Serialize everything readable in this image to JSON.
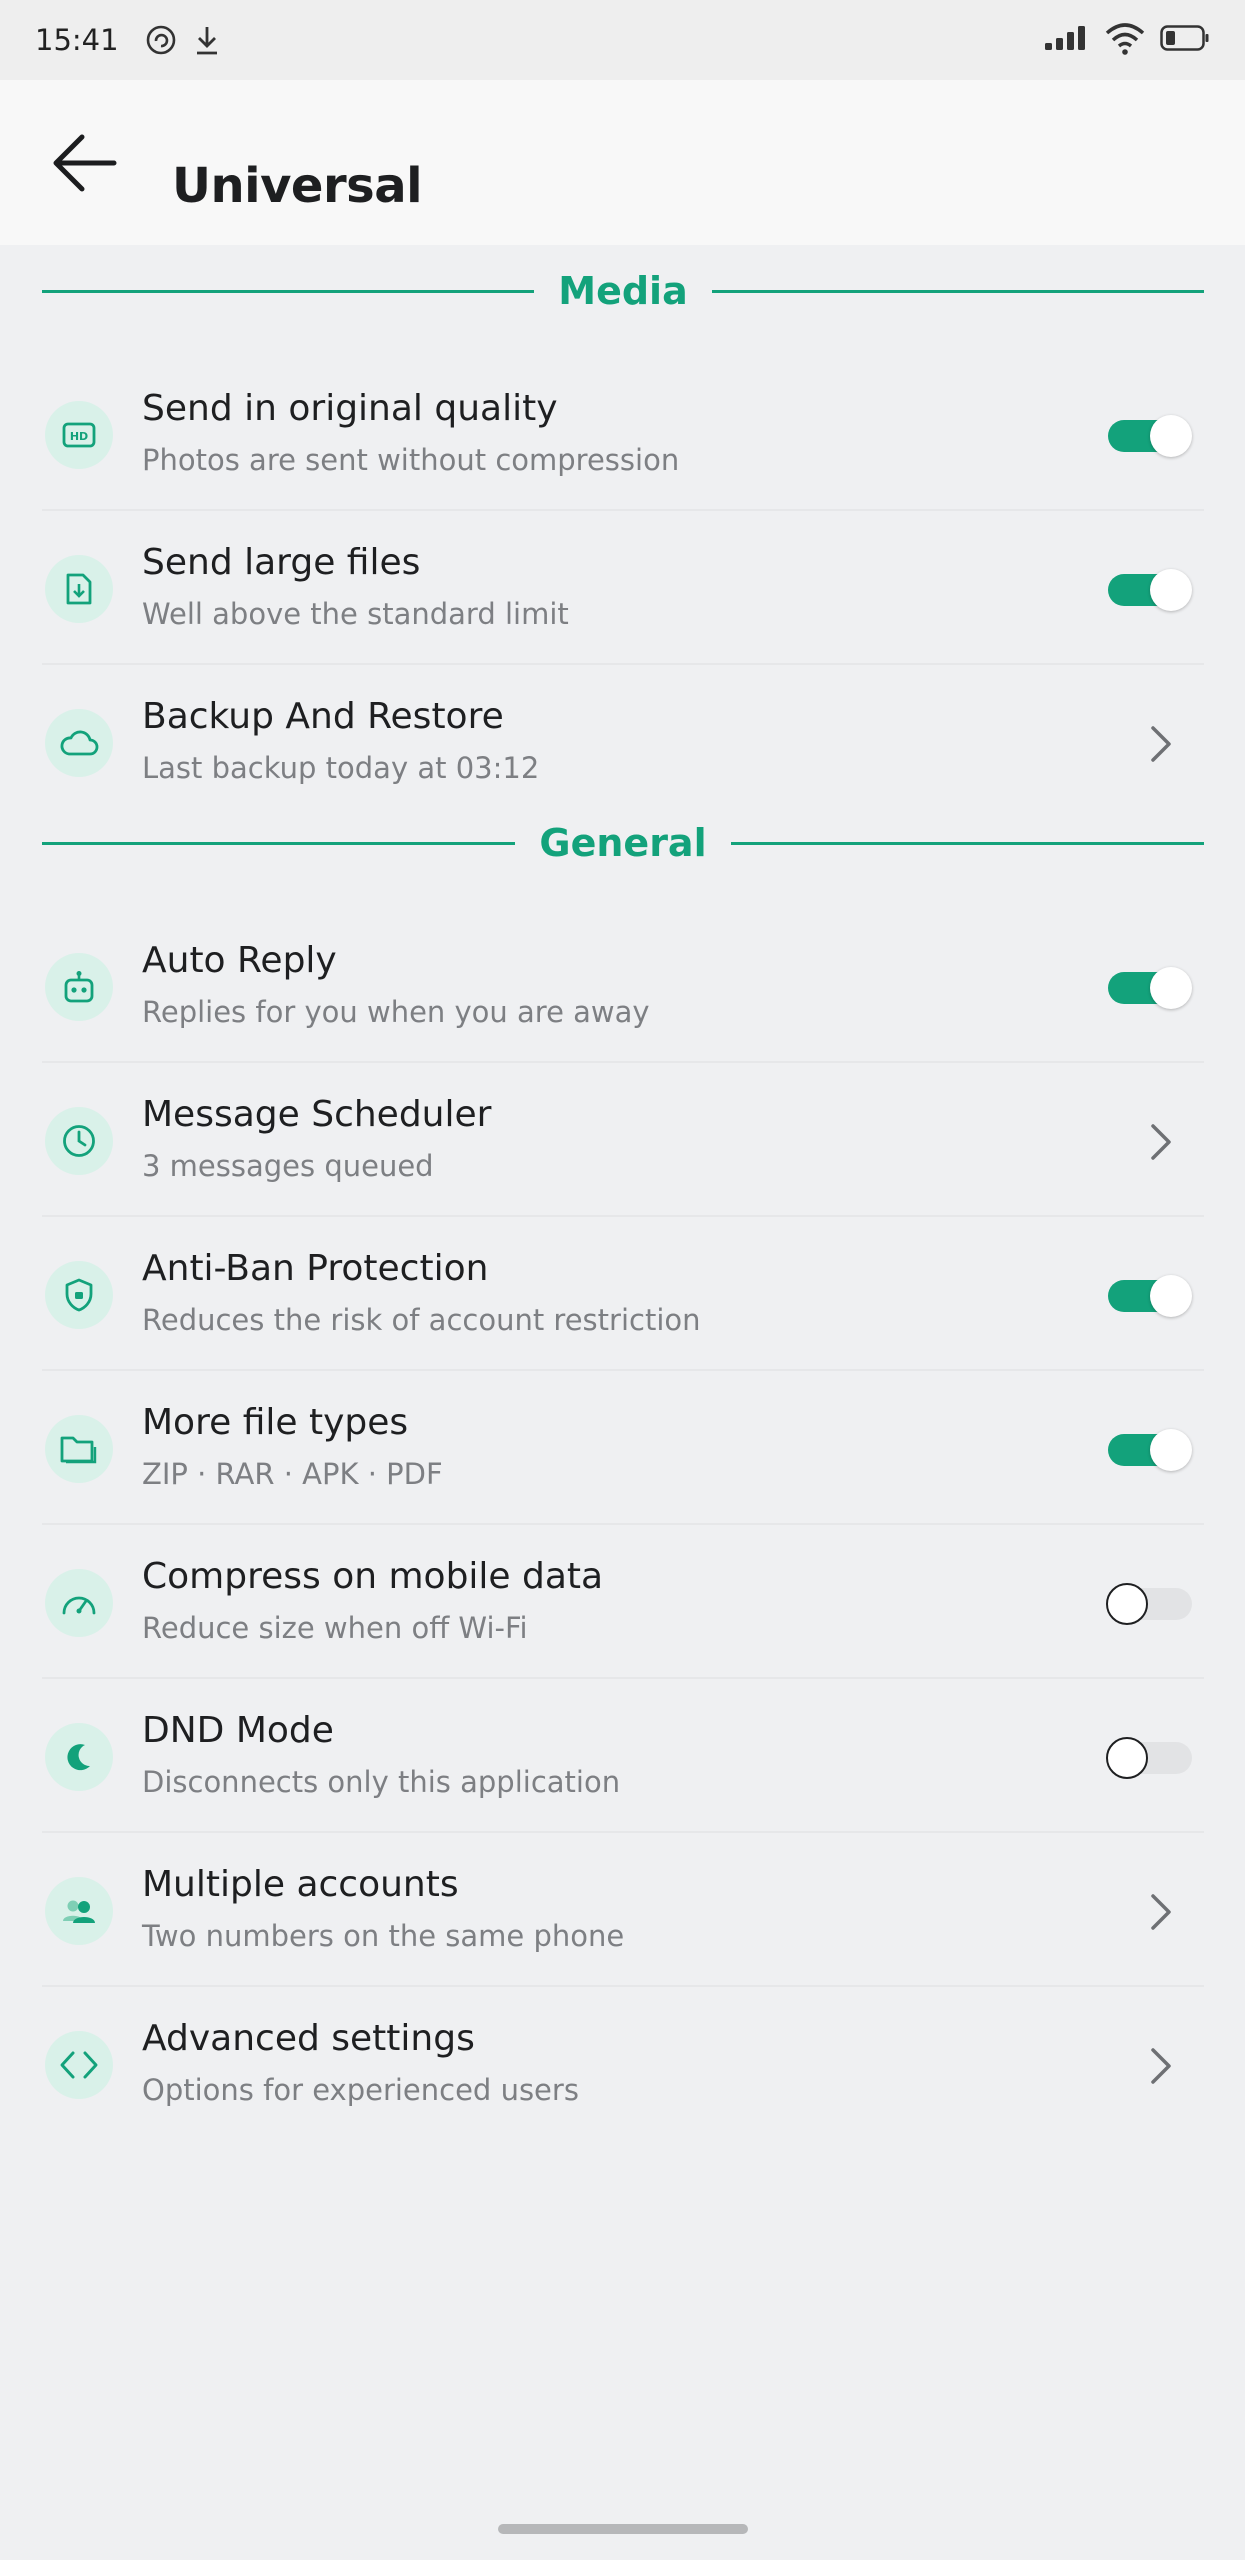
{
  "status_bar": {
    "time": "15:41",
    "icons": [
      "sync-icon",
      "download-icon"
    ],
    "right_icons": [
      "signal-icon",
      "wifi-icon",
      "battery-icon"
    ]
  },
  "header": {
    "title": "Universal",
    "back_icon": "back-arrow-icon"
  },
  "accent_color": "#13a27b",
  "sections": [
    {
      "label": "Media",
      "items": [
        {
          "title": "Send in original quality",
          "subtitle": "Photos are sent without compression",
          "icon": "hd-icon",
          "control": "toggle",
          "enabled": true
        },
        {
          "title": "Send large files",
          "subtitle": "Well above the standard limit",
          "icon": "file-download-icon",
          "control": "toggle",
          "enabled": true
        },
        {
          "title": "Backup And Restore",
          "subtitle": "Last backup today at 03:12",
          "icon": "cloud-icon",
          "control": "chevron"
        }
      ]
    },
    {
      "label": "General",
      "items": [
        {
          "title": "Auto Reply",
          "subtitle": "Replies for you when you are away",
          "icon": "robot-icon",
          "control": "toggle",
          "enabled": true
        },
        {
          "title": "Message Scheduler",
          "subtitle": "3 messages queued",
          "icon": "clock-icon",
          "control": "chevron"
        },
        {
          "title": "Anti-Ban Protection",
          "subtitle": "Reduces the risk of account restriction",
          "icon": "shield-icon",
          "control": "toggle",
          "enabled": true
        },
        {
          "title": "More file types",
          "subtitle": "ZIP · RAR · APK · PDF",
          "icon": "folder-icon",
          "control": "toggle",
          "enabled": true
        },
        {
          "title": "Compress on mobile data",
          "subtitle": "Reduce size when off Wi-Fi",
          "icon": "speedometer-icon",
          "control": "toggle",
          "enabled": false
        },
        {
          "title": "DND Mode",
          "subtitle": "Disconnects only this application",
          "icon": "moon-icon",
          "control": "toggle",
          "enabled": false
        },
        {
          "title": "Multiple accounts",
          "subtitle": "Two numbers on the same phone",
          "icon": "users-icon",
          "control": "chevron"
        },
        {
          "title": "Advanced settings",
          "subtitle": "Options for experienced users",
          "icon": "code-icon",
          "control": "chevron"
        }
      ]
    }
  ]
}
